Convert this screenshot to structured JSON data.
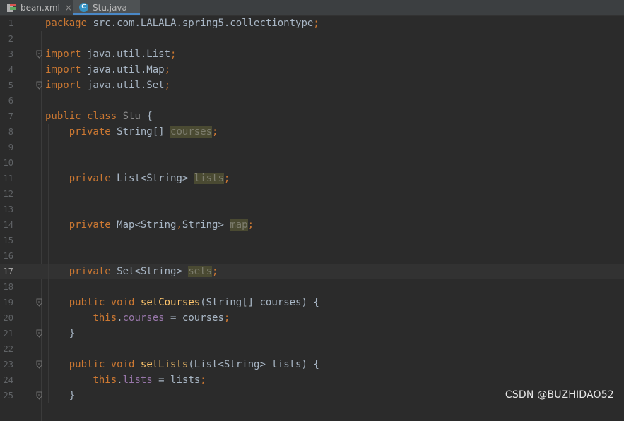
{
  "tabs": [
    {
      "label": "bean.xml",
      "icon": "xml-file-icon",
      "close": "×"
    },
    {
      "label": "Stu.java",
      "icon": "java-class-icon",
      "icon_letter": "C"
    }
  ],
  "editor": {
    "current_line": 17,
    "lines": [
      {
        "n": "1",
        "fold": false,
        "tokens": [
          [
            "kw",
            "package"
          ],
          [
            "t",
            " src.com.LALALA.spring5.collectiontype"
          ],
          [
            "p",
            ";"
          ]
        ]
      },
      {
        "n": "2",
        "fold": false,
        "tokens": []
      },
      {
        "n": "3",
        "fold": true,
        "tokens": [
          [
            "kw",
            "import"
          ],
          [
            "t",
            " java.util.List"
          ],
          [
            "p",
            ";"
          ]
        ]
      },
      {
        "n": "4",
        "fold": false,
        "tokens": [
          [
            "kw",
            "import"
          ],
          [
            "t",
            " java.util.Map"
          ],
          [
            "p",
            ";"
          ]
        ]
      },
      {
        "n": "5",
        "fold": true,
        "tokens": [
          [
            "kw",
            "import"
          ],
          [
            "t",
            " java.util.Set"
          ],
          [
            "p",
            ";"
          ]
        ]
      },
      {
        "n": "6",
        "fold": false,
        "tokens": []
      },
      {
        "n": "7",
        "fold": false,
        "tokens": [
          [
            "kw",
            "public"
          ],
          [
            "t",
            " "
          ],
          [
            "kw",
            "class"
          ],
          [
            "t",
            " "
          ],
          [
            "cls",
            "Stu"
          ],
          [
            "t",
            " {"
          ]
        ]
      },
      {
        "n": "8",
        "fold": false,
        "tokens": [
          [
            "t",
            "    "
          ],
          [
            "kw",
            "private"
          ],
          [
            "t",
            " String[] "
          ],
          [
            "fieldhl",
            "courses"
          ],
          [
            "p",
            ";"
          ]
        ]
      },
      {
        "n": "9",
        "fold": false,
        "tokens": []
      },
      {
        "n": "10",
        "fold": false,
        "tokens": []
      },
      {
        "n": "11",
        "fold": false,
        "tokens": [
          [
            "t",
            "    "
          ],
          [
            "kw",
            "private"
          ],
          [
            "t",
            " List<String> "
          ],
          [
            "fieldhl",
            "lists"
          ],
          [
            "p",
            ";"
          ]
        ]
      },
      {
        "n": "12",
        "fold": false,
        "tokens": []
      },
      {
        "n": "13",
        "fold": false,
        "tokens": []
      },
      {
        "n": "14",
        "fold": false,
        "tokens": [
          [
            "t",
            "    "
          ],
          [
            "kw",
            "private"
          ],
          [
            "t",
            " Map<String"
          ],
          [
            "p",
            ","
          ],
          [
            "t",
            "String> "
          ],
          [
            "fieldhl",
            "map"
          ],
          [
            "p",
            ";"
          ]
        ]
      },
      {
        "n": "15",
        "fold": false,
        "tokens": []
      },
      {
        "n": "16",
        "fold": false,
        "tokens": []
      },
      {
        "n": "17",
        "fold": false,
        "tokens": [
          [
            "t",
            "    "
          ],
          [
            "kw",
            "private"
          ],
          [
            "t",
            " Set<String> "
          ],
          [
            "fieldhl",
            "sets"
          ],
          [
            "p",
            ";"
          ],
          [
            "caret",
            ""
          ]
        ]
      },
      {
        "n": "18",
        "fold": false,
        "tokens": []
      },
      {
        "n": "19",
        "fold": true,
        "tokens": [
          [
            "t",
            "    "
          ],
          [
            "kw",
            "public"
          ],
          [
            "t",
            " "
          ],
          [
            "kw",
            "void"
          ],
          [
            "t",
            " "
          ],
          [
            "mth",
            "setCourses"
          ],
          [
            "t",
            "(String[] courses) {"
          ]
        ]
      },
      {
        "n": "20",
        "fold": false,
        "tokens": [
          [
            "t",
            "        "
          ],
          [
            "kw",
            "this"
          ],
          [
            "t",
            "."
          ],
          [
            "field",
            "courses"
          ],
          [
            "t",
            " = courses"
          ],
          [
            "p",
            ";"
          ]
        ]
      },
      {
        "n": "21",
        "fold": true,
        "tokens": [
          [
            "t",
            "    }"
          ]
        ]
      },
      {
        "n": "22",
        "fold": false,
        "tokens": []
      },
      {
        "n": "23",
        "fold": true,
        "tokens": [
          [
            "t",
            "    "
          ],
          [
            "kw",
            "public"
          ],
          [
            "t",
            " "
          ],
          [
            "kw",
            "void"
          ],
          [
            "t",
            " "
          ],
          [
            "mth",
            "setLists"
          ],
          [
            "t",
            "(List<String> lists) {"
          ]
        ]
      },
      {
        "n": "24",
        "fold": false,
        "tokens": [
          [
            "t",
            "        "
          ],
          [
            "kw",
            "this"
          ],
          [
            "t",
            "."
          ],
          [
            "field",
            "lists"
          ],
          [
            "t",
            " = lists"
          ],
          [
            "p",
            ";"
          ]
        ]
      },
      {
        "n": "25",
        "fold": true,
        "tokens": [
          [
            "t",
            "    }"
          ]
        ]
      }
    ]
  },
  "colors": {
    "keyword": "#cc7832",
    "text": "#a9b7c6",
    "field": "#9876aa",
    "method": "#ffc66d",
    "class_unused": "#8a8a8a",
    "field_highlight_bg": "#4a4a32",
    "field_unused": "#7d7d6e"
  },
  "watermark": "CSDN @BUZHIDAO52"
}
